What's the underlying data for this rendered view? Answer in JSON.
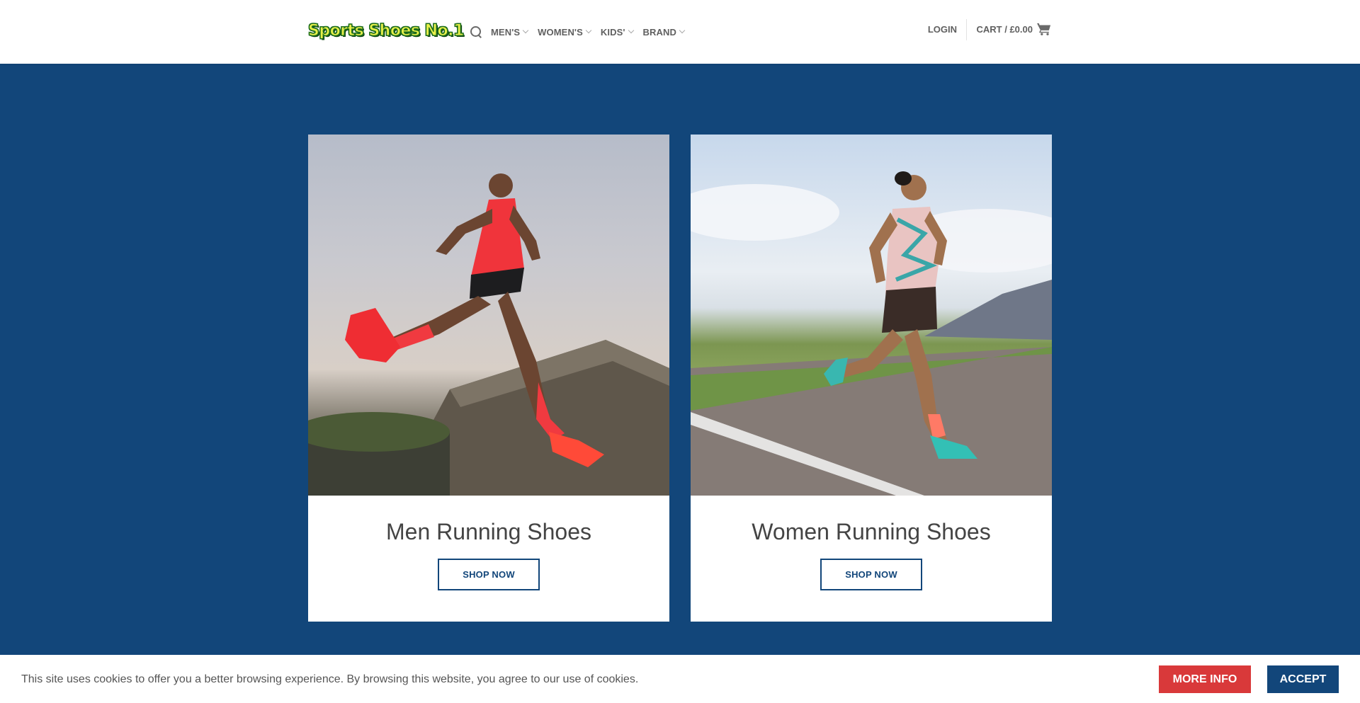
{
  "header": {
    "logo_text": "Sports Shoes No.1",
    "nav": [
      {
        "label": "MEN'S",
        "name": "mens"
      },
      {
        "label": "WOMEN'S",
        "name": "womens"
      },
      {
        "label": "KIDS'",
        "name": "kids"
      },
      {
        "label": "BRAND",
        "name": "brand"
      }
    ],
    "login_label": "LOGIN",
    "cart_label": "CART / £0.00"
  },
  "cards": [
    {
      "title": "Men Running Shoes",
      "button_label": "SHOP NOW"
    },
    {
      "title": "Women Running Shoes",
      "button_label": "SHOP NOW"
    }
  ],
  "cookie_bar": {
    "message": "This site uses cookies to offer you a better browsing experience. By browsing this website, you agree to our use of cookies.",
    "more_info_label": "MORE INFO",
    "accept_label": "ACCEPT"
  },
  "colors": {
    "primary": "#12467a",
    "accent_red": "#d9393a",
    "logo_yellow": "#e8f04a",
    "logo_green": "#1d6d1d"
  },
  "icons": {
    "search": "search-icon",
    "cart": "cart-icon",
    "dropdown": "chevron-down-icon"
  }
}
